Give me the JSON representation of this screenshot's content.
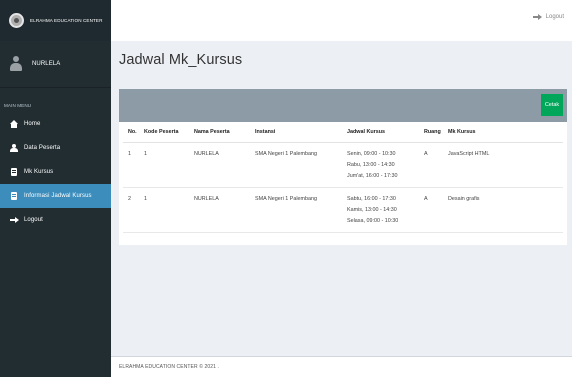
{
  "sidebar": {
    "brand": "ELRAHMA EDUCATION CENTER",
    "user_name": "NURLELA",
    "menu_header": "MAIN MENU",
    "items": [
      {
        "label": "Home",
        "icon": "home-icon"
      },
      {
        "label": "Data Peserta",
        "icon": "user-icon"
      },
      {
        "label": "Mk Kursus",
        "icon": "book-icon"
      },
      {
        "label": "Informasi Jadwal Kursus",
        "icon": "list-icon",
        "active": true
      },
      {
        "label": "Logout",
        "icon": "sign-out-icon"
      }
    ]
  },
  "topbar": {
    "logout_label": "Logout"
  },
  "main": {
    "title": "Jadwal Mk_Kursus",
    "print_label": "Cetak",
    "columns": [
      "No.",
      "Kode Peserta",
      "Nama Peserta",
      "Instansi",
      "Jadwal Kursus",
      "Ruang",
      "Mk Kursus"
    ],
    "rows": [
      {
        "no": "1",
        "kode": "1",
        "nama": "NURLELA",
        "instansi": "SMA Negeri 1 Palembang",
        "jadwal": [
          "Senin, 09:00 - 10:30",
          "Rabu, 13:00 - 14:30",
          "Jum'at, 16:00 - 17:30"
        ],
        "ruang": "A",
        "mk": "JavaScript HTML"
      },
      {
        "no": "2",
        "kode": "1",
        "nama": "NURLELA",
        "instansi": "SMA Negeri 1 Palembang",
        "jadwal": [
          "Sabtu, 16:00 - 17:30",
          "Kamis, 13:00 - 14:30",
          "Selasa, 09:00 - 10:30"
        ],
        "ruang": "A",
        "mk": "Desain grafis"
      }
    ]
  },
  "footer": {
    "text": "ELRAHMA EDUCATION CENTER © 2021 ."
  },
  "colors": {
    "sidebar_bg": "#222d32",
    "active_item": "#3c8dbc",
    "box_header": "#8c9ba6",
    "print_button": "#00a65a",
    "content_bg": "#ecf0f5"
  }
}
